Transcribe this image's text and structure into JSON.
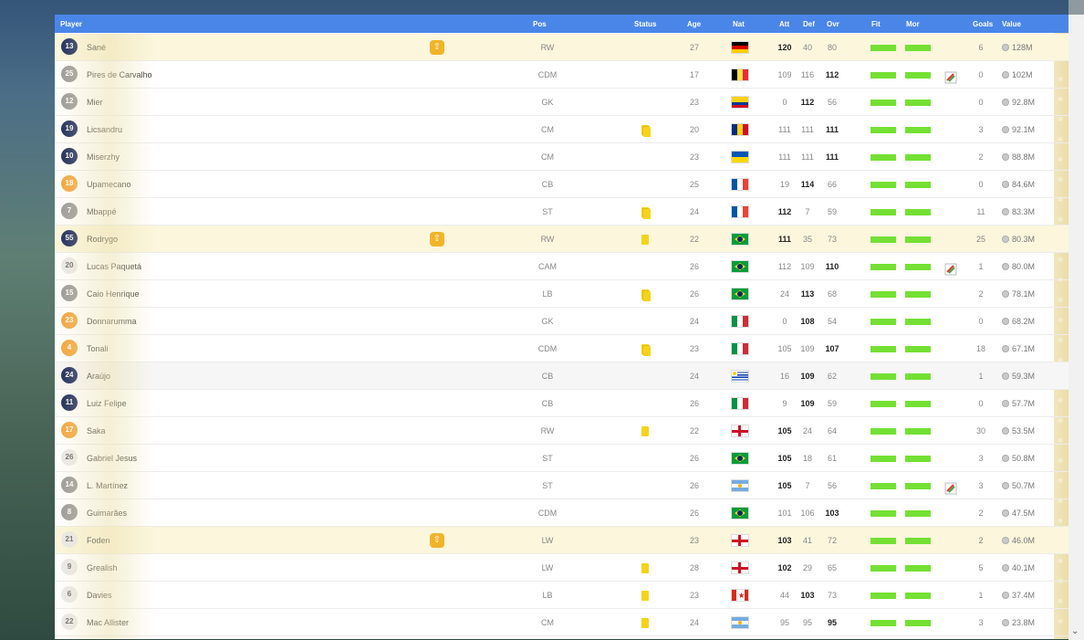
{
  "header": {
    "player": "Player",
    "pos": "Pos",
    "status": "Status",
    "age": "Age",
    "nat": "Nat",
    "att": "Att",
    "def": "Def",
    "ovr": "Ovr",
    "fit": "Fit",
    "mor": "Mor",
    "goals": "Goals",
    "value": "Value"
  },
  "icons": {
    "upgrade": "shield-up-icon",
    "transfer": "transfer-icon",
    "coin": "coin-icon",
    "scroll": "chevron-down-icon"
  },
  "colors": {
    "header": "#4a86e8",
    "fit": "#74e033",
    "card": "#f5d31c",
    "badge": "#f0b429"
  },
  "players": [
    {
      "num": "13",
      "jersey": "navy",
      "name": "Sané",
      "pos": "RW",
      "status": "",
      "age": "27",
      "nat": "de",
      "att": "120",
      "def": "40",
      "ovr": "80",
      "bold": "att",
      "goals": "6",
      "value": "128M",
      "badge": true,
      "transfer": false,
      "row": "hl"
    },
    {
      "num": "25",
      "jersey": "grey",
      "name": "Pires de Carvalho",
      "pos": "CDM",
      "status": "",
      "age": "17",
      "nat": "be",
      "att": "109",
      "def": "116",
      "ovr": "112",
      "bold": "ovr",
      "goals": "0",
      "value": "102M",
      "badge": false,
      "transfer": true,
      "row": ""
    },
    {
      "num": "12",
      "jersey": "grey",
      "name": "Mier",
      "pos": "GK",
      "status": "",
      "age": "23",
      "nat": "co",
      "att": "0",
      "def": "112",
      "ovr": "56",
      "bold": "def",
      "goals": "0",
      "value": "92.8M",
      "badge": false,
      "transfer": false,
      "row": ""
    },
    {
      "num": "19",
      "jersey": "navy",
      "name": "Licsandru",
      "pos": "CM",
      "status": "double",
      "age": "20",
      "nat": "ro",
      "att": "111",
      "def": "111",
      "ovr": "111",
      "bold": "ovr",
      "goals": "3",
      "value": "92.1M",
      "badge": false,
      "transfer": false,
      "row": ""
    },
    {
      "num": "10",
      "jersey": "navy",
      "name": "Miserzhy",
      "pos": "CM",
      "status": "",
      "age": "23",
      "nat": "ua",
      "att": "111",
      "def": "111",
      "ovr": "111",
      "bold": "ovr",
      "goals": "2",
      "value": "88.8M",
      "badge": false,
      "transfer": false,
      "row": ""
    },
    {
      "num": "18",
      "jersey": "orange",
      "name": "Upamecano",
      "pos": "CB",
      "status": "",
      "age": "25",
      "nat": "fr",
      "att": "19",
      "def": "114",
      "ovr": "66",
      "bold": "def",
      "goals": "0",
      "value": "84.6M",
      "badge": false,
      "transfer": false,
      "row": ""
    },
    {
      "num": "7",
      "jersey": "grey",
      "name": "Mbappé",
      "pos": "ST",
      "status": "double",
      "age": "24",
      "nat": "fr",
      "att": "112",
      "def": "7",
      "ovr": "59",
      "bold": "att",
      "goals": "11",
      "value": "83.3M",
      "badge": false,
      "transfer": false,
      "row": ""
    },
    {
      "num": "55",
      "jersey": "navy",
      "name": "Rodrygo",
      "pos": "RW",
      "status": "single",
      "age": "22",
      "nat": "br",
      "att": "111",
      "def": "35",
      "ovr": "73",
      "bold": "att",
      "goals": "25",
      "value": "80.3M",
      "badge": true,
      "transfer": false,
      "row": "hl"
    },
    {
      "num": "20",
      "jersey": "white",
      "name": "Lucas Paquetá",
      "pos": "CAM",
      "status": "",
      "age": "26",
      "nat": "br",
      "att": "112",
      "def": "109",
      "ovr": "110",
      "bold": "ovr",
      "goals": "1",
      "value": "80.0M",
      "badge": false,
      "transfer": true,
      "row": ""
    },
    {
      "num": "15",
      "jersey": "grey",
      "name": "Caio Henrique",
      "pos": "LB",
      "status": "double",
      "age": "26",
      "nat": "br",
      "att": "24",
      "def": "113",
      "ovr": "68",
      "bold": "def",
      "goals": "2",
      "value": "78.1M",
      "badge": false,
      "transfer": false,
      "row": ""
    },
    {
      "num": "23",
      "jersey": "orange",
      "name": "Donnarumma",
      "pos": "GK",
      "status": "",
      "age": "24",
      "nat": "it",
      "att": "0",
      "def": "108",
      "ovr": "54",
      "bold": "def",
      "goals": "0",
      "value": "68.2M",
      "badge": false,
      "transfer": false,
      "row": ""
    },
    {
      "num": "4",
      "jersey": "orange",
      "name": "Tonali",
      "pos": "CDM",
      "status": "double",
      "age": "23",
      "nat": "it",
      "att": "105",
      "def": "109",
      "ovr": "107",
      "bold": "ovr",
      "goals": "18",
      "value": "67.1M",
      "badge": false,
      "transfer": false,
      "row": ""
    },
    {
      "num": "24",
      "jersey": "navy",
      "name": "Araújo",
      "pos": "CB",
      "status": "",
      "age": "24",
      "nat": "uy",
      "att": "16",
      "def": "109",
      "ovr": "62",
      "bold": "def",
      "goals": "1",
      "value": "59.3M",
      "badge": false,
      "transfer": false,
      "row": "alt"
    },
    {
      "num": "11",
      "jersey": "navy",
      "name": "Luiz Felipe",
      "pos": "CB",
      "status": "",
      "age": "26",
      "nat": "it",
      "att": "9",
      "def": "109",
      "ovr": "59",
      "bold": "def",
      "goals": "0",
      "value": "57.7M",
      "badge": false,
      "transfer": false,
      "row": ""
    },
    {
      "num": "17",
      "jersey": "orange",
      "name": "Saka",
      "pos": "RW",
      "status": "single",
      "age": "22",
      "nat": "en",
      "att": "105",
      "def": "24",
      "ovr": "64",
      "bold": "att",
      "goals": "30",
      "value": "53.5M",
      "badge": false,
      "transfer": false,
      "row": ""
    },
    {
      "num": "26",
      "jersey": "white",
      "name": "Gabriel Jesus",
      "pos": "ST",
      "status": "",
      "age": "26",
      "nat": "br",
      "att": "105",
      "def": "18",
      "ovr": "61",
      "bold": "att",
      "goals": "3",
      "value": "50.8M",
      "badge": false,
      "transfer": false,
      "row": ""
    },
    {
      "num": "14",
      "jersey": "grey",
      "name": "L. Martínez",
      "pos": "ST",
      "status": "",
      "age": "26",
      "nat": "ar",
      "att": "105",
      "def": "7",
      "ovr": "56",
      "bold": "att",
      "goals": "3",
      "value": "50.7M",
      "badge": false,
      "transfer": true,
      "row": ""
    },
    {
      "num": "8",
      "jersey": "grey",
      "name": "Guimarães",
      "pos": "CDM",
      "status": "",
      "age": "26",
      "nat": "br",
      "att": "101",
      "def": "106",
      "ovr": "103",
      "bold": "ovr",
      "goals": "2",
      "value": "47.5M",
      "badge": false,
      "transfer": false,
      "row": ""
    },
    {
      "num": "21",
      "jersey": "white",
      "name": "Foden",
      "pos": "LW",
      "status": "",
      "age": "23",
      "nat": "en",
      "att": "103",
      "def": "41",
      "ovr": "72",
      "bold": "att",
      "goals": "2",
      "value": "46.0M",
      "badge": true,
      "transfer": false,
      "row": "hl"
    },
    {
      "num": "9",
      "jersey": "white",
      "name": "Grealish",
      "pos": "LW",
      "status": "single",
      "age": "28",
      "nat": "en",
      "att": "102",
      "def": "29",
      "ovr": "65",
      "bold": "att",
      "goals": "5",
      "value": "40.1M",
      "badge": false,
      "transfer": false,
      "row": ""
    },
    {
      "num": "6",
      "jersey": "white",
      "name": "Davies",
      "pos": "LB",
      "status": "single",
      "age": "23",
      "nat": "ca",
      "att": "44",
      "def": "103",
      "ovr": "73",
      "bold": "def",
      "goals": "1",
      "value": "37.4M",
      "badge": false,
      "transfer": false,
      "row": ""
    },
    {
      "num": "22",
      "jersey": "white",
      "name": "Mac Allister",
      "pos": "CM",
      "status": "single",
      "age": "24",
      "nat": "ar",
      "att": "95",
      "def": "95",
      "ovr": "95",
      "bold": "ovr",
      "goals": "3",
      "value": "23.8M",
      "badge": false,
      "transfer": false,
      "row": ""
    }
  ]
}
